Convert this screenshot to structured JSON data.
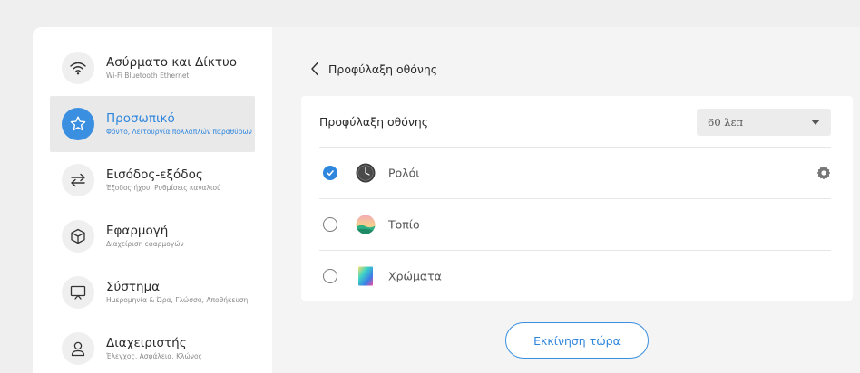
{
  "sidebar": {
    "items": [
      {
        "title": "Ασύρματο και Δίκτυο",
        "subtitle": "Wi-Fi Bluetooth Ethernet",
        "icon": "wifi-icon",
        "active": false
      },
      {
        "title": "Προσωπικό",
        "subtitle": "Φόντο, Λειτουργία πολλαπλών παραθύρων",
        "icon": "star-icon",
        "active": true
      },
      {
        "title": "Εισόδος-εξόδος",
        "subtitle": "Έξοδος ήχου, Ρυθμίσεις καναλιού",
        "icon": "swap-arrows-icon",
        "active": false
      },
      {
        "title": "Εφαρμογή",
        "subtitle": "Διαχείριση εφαρμογών",
        "icon": "cube-icon",
        "active": false
      },
      {
        "title": "Σύστημα",
        "subtitle": "Ημερομηνία & Ώρα, Γλώσσα, Αποθήκευση",
        "icon": "display-icon",
        "active": false
      },
      {
        "title": "Διαχειριστής",
        "subtitle": "Έλεγχος, Ασφάλεια, Κλώνος",
        "icon": "user-icon",
        "active": false
      }
    ]
  },
  "header": {
    "title": "Προφύλαξη οθόνης"
  },
  "screensaver": {
    "label": "Προφύλαξη οθόνης",
    "timeout_value": "60 λεπ",
    "options": [
      {
        "label": "Ρολόι",
        "selected": true,
        "icon": "clock-icon"
      },
      {
        "label": "Τοπίο",
        "selected": false,
        "icon": "landscape-icon"
      },
      {
        "label": "Χρώματα",
        "selected": false,
        "icon": "colors-icon"
      }
    ]
  },
  "actions": {
    "start_label": "Εκκίνηση τώρα"
  },
  "colors": {
    "accent": "#2f86dd",
    "active_bg": "#e9e9e9",
    "content_bg": "#f4f4f4"
  }
}
